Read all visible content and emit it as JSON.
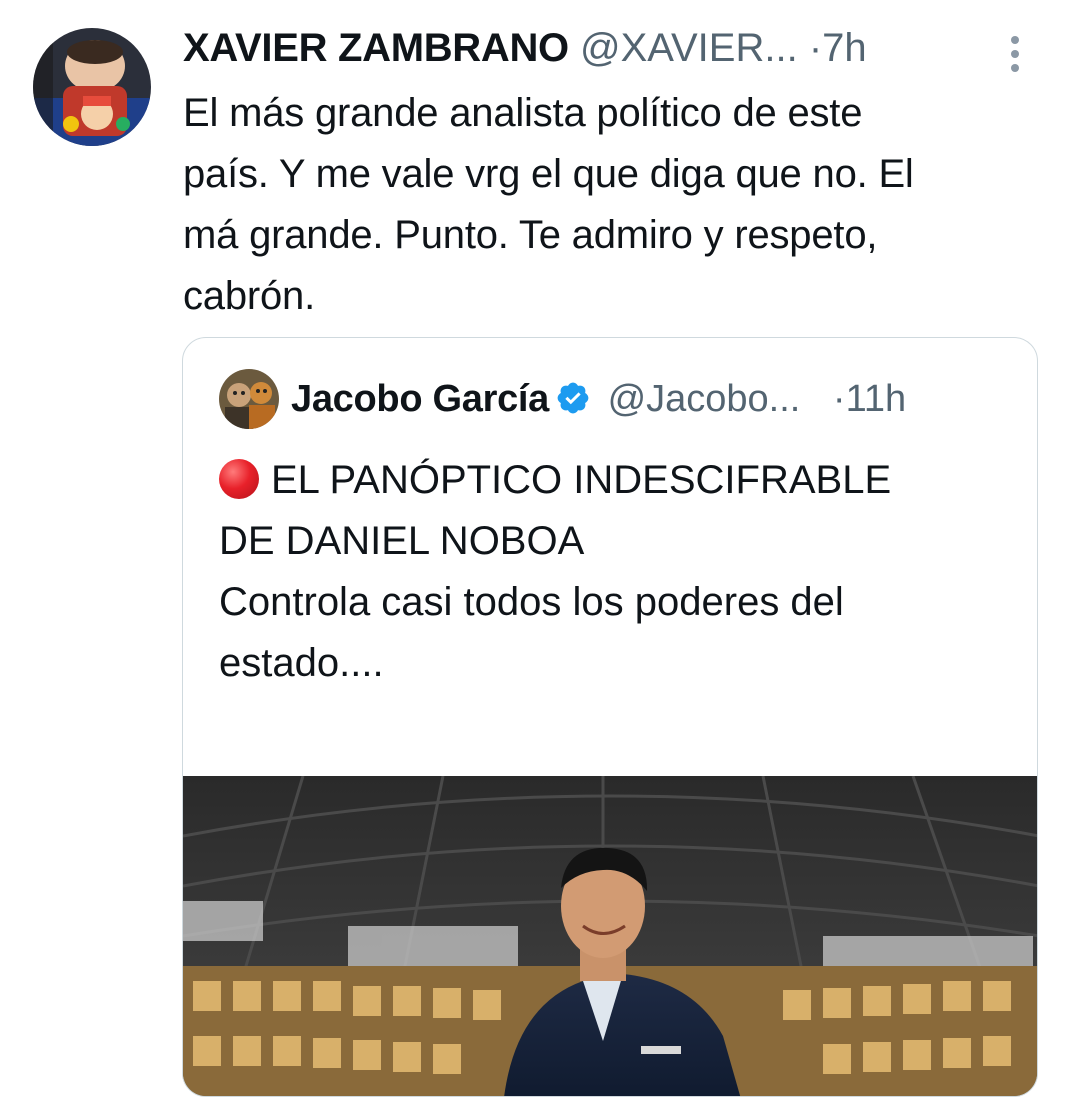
{
  "tweet": {
    "display_name": "XAVIER ZAMBRANO",
    "handle": "@XAVIER...",
    "separator": "·",
    "time": "7h",
    "text": "El más grande analista político de este\npaís. Y me vale vrg el que diga que no. El\nmá grande. Punto. Te admiro y respeto,\ncabrón."
  },
  "quote": {
    "display_name": "Jacobo García",
    "verified": true,
    "handle": "@Jacobo...",
    "separator": "·",
    "time": "11h",
    "lines": [
      "EL PANÓPTICO INDESCIFRABLE",
      "DE DANIEL NOBOA",
      "",
      "Controla casi todos los poderes del",
      "estado...."
    ],
    "lead_icon": "red-circle-icon",
    "image_subject": "man in suit smiling inside circular panopticon building"
  },
  "colors": {
    "text": "#0f1419",
    "secondary": "#536471",
    "border": "#cfd9de",
    "verified": "#1d9bf0",
    "red_circle": "#e8212a"
  },
  "icons": {
    "more": "more-vertical-icon",
    "verified": "verified-badge-icon"
  }
}
